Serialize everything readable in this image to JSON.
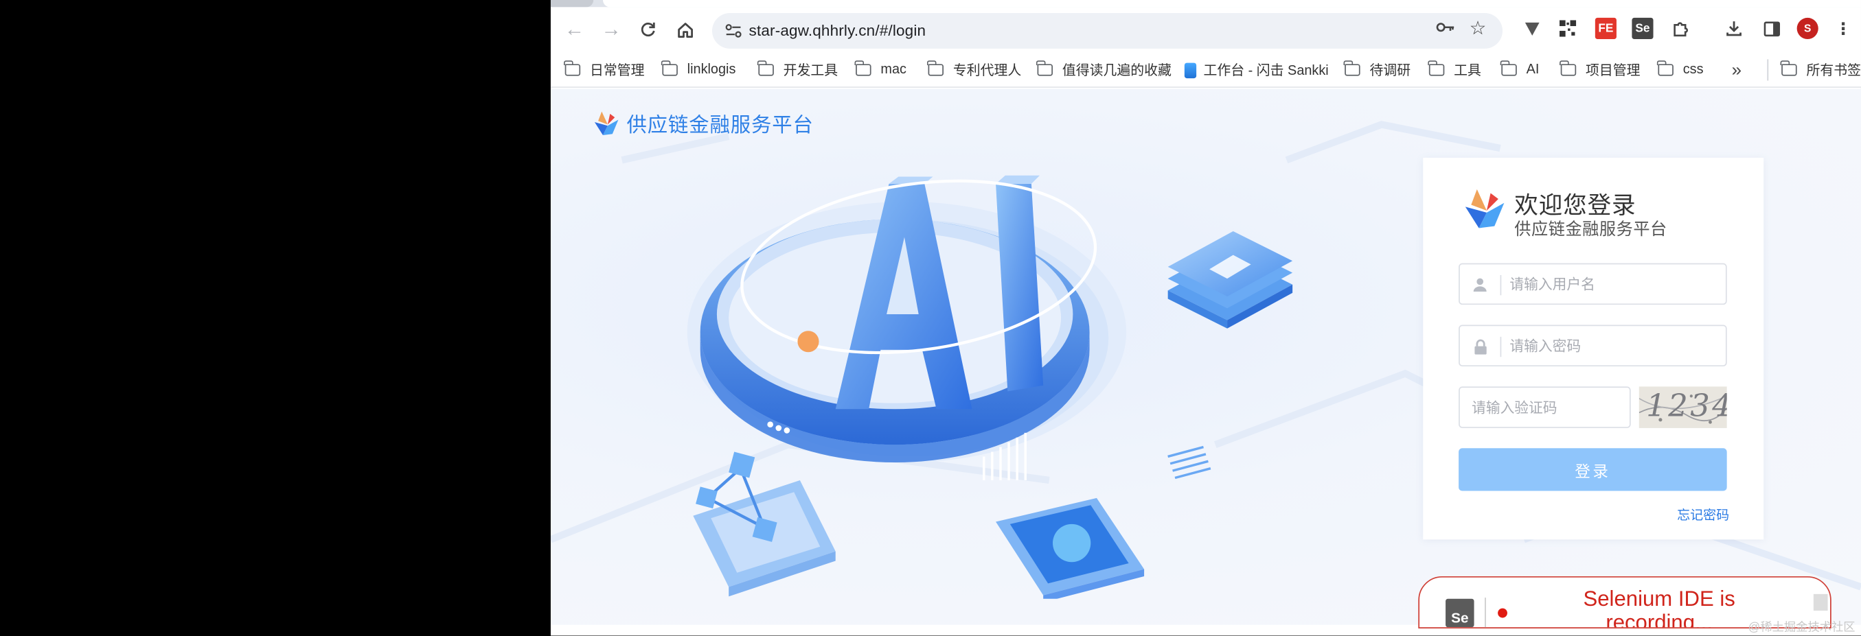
{
  "browser": {
    "url": "star-agw.qhhrly.cn/#/login",
    "profile_initial": "S",
    "colors": {
      "profile": "#c5221f",
      "accent": "#2f80e6"
    },
    "bookmarks": [
      "日常管理",
      "linklogis",
      "开发工具",
      "mac",
      "专利代理人",
      "值得读几遍的收藏",
      "工作台 - 闪击 Sankki",
      "待调研",
      "工具",
      "AI",
      "项目管理",
      "css"
    ],
    "bookmarks_overflow": "»",
    "all_bookmarks": "所有书签"
  },
  "page": {
    "brand_title": "供应链金融服务平台",
    "illustration_text": "AI"
  },
  "login": {
    "welcome": "欢迎您登录",
    "subtitle": "供应链金融服务平台",
    "username_placeholder": "请输入用户名",
    "password_placeholder": "请输入密码",
    "captcha_placeholder": "请输入验证码",
    "captcha_code": "1234",
    "login_button": "登录",
    "forgot_password": "忘记密码"
  },
  "selenium": {
    "logo_text": "Se",
    "message": "Selenium IDE is recording..."
  },
  "watermark": "@稀土掘金技术社区"
}
